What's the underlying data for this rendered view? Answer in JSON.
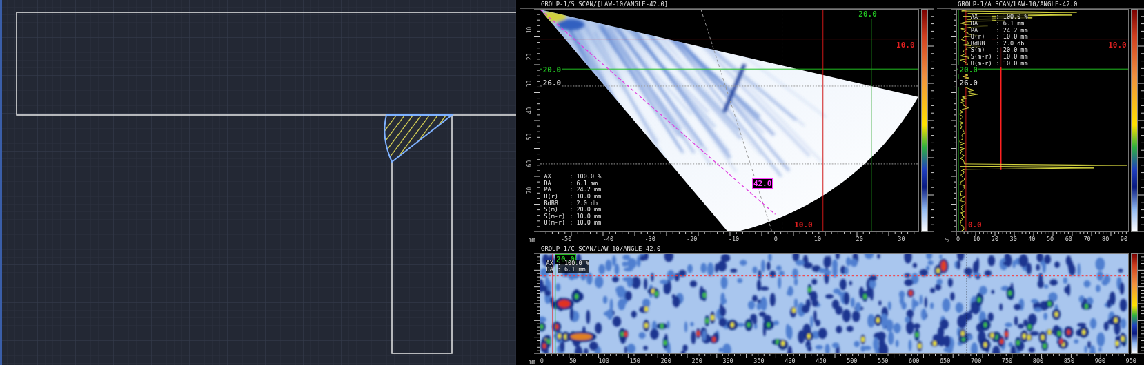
{
  "s_scan": {
    "title": "GROUP-1/S SCAN/[LAW-10/ANGLE-42.0]",
    "cursor_labels": [
      {
        "text": "20.0",
        "color": "#22c022"
      },
      {
        "text": "10.0",
        "color": "#e02020"
      },
      {
        "text": "20.0",
        "color": "#22c022"
      },
      {
        "text": "26.0",
        "color": "#cccccc"
      },
      {
        "text": "42.0",
        "color": "#ff40ff"
      },
      {
        "text": "10.0",
        "color": "#e02020"
      }
    ],
    "readouts": [
      {
        "label": "AX",
        "value": ": 100.0 %"
      },
      {
        "label": "DA",
        "value": ": 6.1 mm"
      },
      {
        "label": "PA",
        "value": ": 24.2 mm"
      },
      {
        "label": "U(r)",
        "value": ": 10.0 mm"
      },
      {
        "label": "BdBB",
        "value": ": 2.0 db"
      },
      {
        "label": "S(m)",
        "value": ": 20.0 mm"
      },
      {
        "label": "S(m-r)",
        "value": ": 10.0 mm"
      },
      {
        "label": "U(m-r)",
        "value": ": 10.0 mm"
      }
    ],
    "x_ticks": [
      "-50",
      "-40",
      "-30",
      "-20",
      "-10",
      "0",
      "10",
      "20",
      "30"
    ],
    "x_unit": "mm",
    "y_ticks": [
      "10",
      "20",
      "30",
      "40",
      "50",
      "60",
      "70"
    ]
  },
  "a_scan": {
    "title": "GROUP-1/A SCAN/LAW-10/ANGLE-42.0",
    "cursor_labels": [
      {
        "text": "10.0",
        "color": "#e02020"
      },
      {
        "text": "20.0",
        "color": "#22c022"
      },
      {
        "text": "26.0",
        "color": "#cccccc"
      },
      {
        "text": "0.0",
        "color": "#e02020"
      }
    ],
    "readouts": [
      {
        "label": "AX",
        "value": ": 100.0 %"
      },
      {
        "label": "DA",
        "value": ": 6.1 mm"
      },
      {
        "label": "PA",
        "value": ": 24.2 mm"
      },
      {
        "label": "U(r)",
        "value": ": 10.0 mm"
      },
      {
        "label": "BdBB",
        "value": ": 2.0 db"
      },
      {
        "label": "S(m)",
        "value": ": 20.0 mm"
      },
      {
        "label": "S(m-r)",
        "value": ": 10.0 mm"
      },
      {
        "label": "U(m-r)",
        "value": ": 10.0 mm"
      }
    ],
    "x_ticks": [
      "0",
      "10",
      "20",
      "30",
      "40",
      "50",
      "60",
      "70",
      "80",
      "90"
    ],
    "x_unit": "%"
  },
  "c_scan": {
    "title": "GROUP-1/C SCAN/LAW-10/ANGLE-42.0",
    "cursor_labels": [
      {
        "text": "20.0",
        "color": "#22c022"
      }
    ],
    "readouts": [
      {
        "label": "AX",
        "value": ": 100.0 %"
      },
      {
        "label": "DA",
        "value": ": 6.1 mm"
      }
    ],
    "x_ticks": [
      "0",
      "50",
      "100",
      "150",
      "200",
      "250",
      "300",
      "350",
      "400",
      "450",
      "500",
      "550",
      "600",
      "650",
      "700",
      "750",
      "800",
      "850",
      "900",
      "950"
    ],
    "x_unit": "mm"
  }
}
